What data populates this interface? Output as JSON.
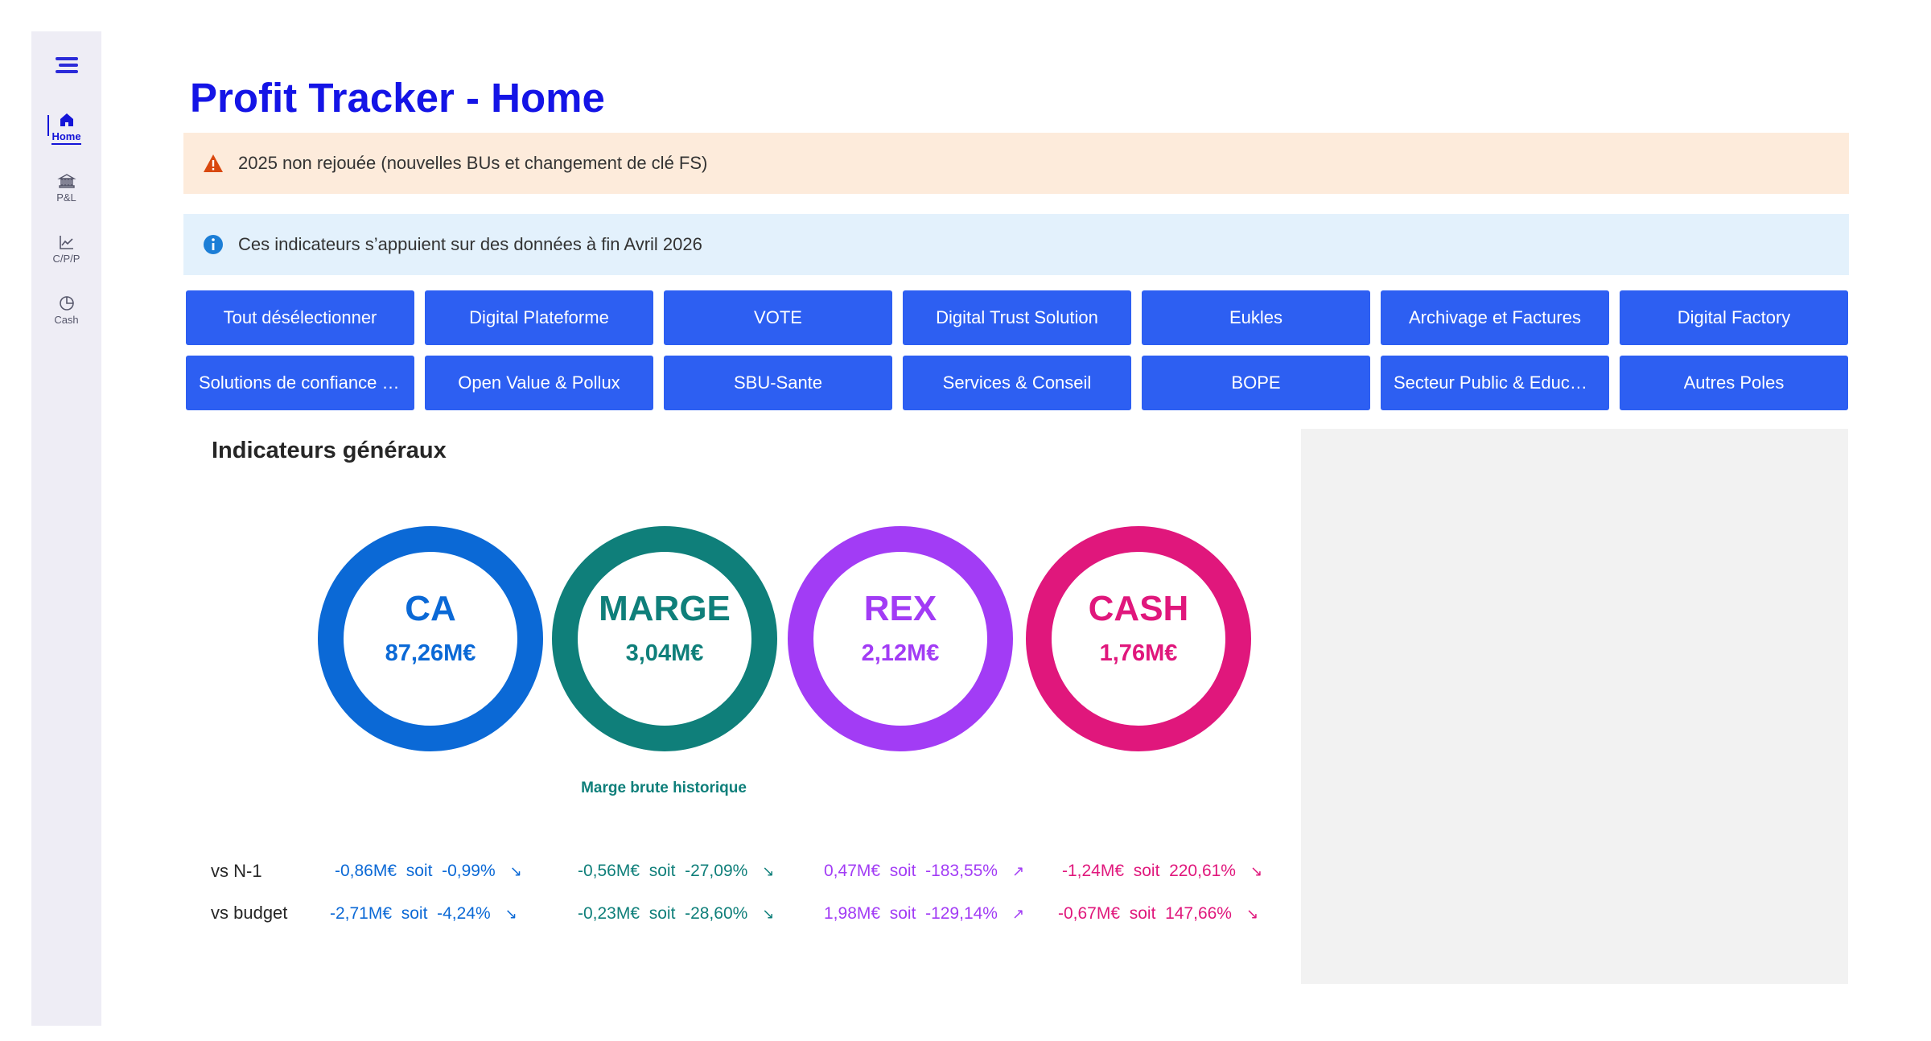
{
  "sidebar": {
    "menu_icon": "hamburger-icon",
    "items": [
      {
        "label": "Home",
        "icon": "home-icon",
        "active": true
      },
      {
        "label": "P&L",
        "icon": "bank-icon",
        "active": false
      },
      {
        "label": "C/P/P",
        "icon": "line-chart-icon",
        "active": false
      },
      {
        "label": "Cash",
        "icon": "pie-chart-icon",
        "active": false
      }
    ]
  },
  "page": {
    "title": "Profit Tracker - Home"
  },
  "alerts": {
    "warning": {
      "text": "2025 non rejouée (nouvelles BUs et changement de clé FS)",
      "icon": "warning-icon",
      "color": "#d9480f"
    },
    "info": {
      "text": "Ces indicateurs s’appuient sur des données à fin Avril 2026",
      "icon": "info-icon",
      "color": "#1c7ed6"
    }
  },
  "filters": [
    "Tout désélectionner",
    "Digital Plateforme",
    "VOTE",
    "Digital Trust Solution",
    "Eukles",
    "Archivage et Factures",
    "Digital Factory",
    "Solutions de confiance Grand Public",
    "Open Value & Pollux",
    "SBU-Sante",
    "Services & Conseil",
    "BOPE",
    "Secteur Public & Education",
    "Autres Poles"
  ],
  "filter_color": "#2d5ff2",
  "section": {
    "title": "Indicateurs généraux"
  },
  "kpis": [
    {
      "name": "CA",
      "value": "87,26M€",
      "color": "#0b69d6"
    },
    {
      "name": "MARGE",
      "value": "3,04M€",
      "color": "#0f7f7a",
      "note": "Marge brute historique"
    },
    {
      "name": "REX",
      "value": "2,12M€",
      "color": "#a23cf5"
    },
    {
      "name": "CASH",
      "value": "1,76M€",
      "color": "#e0177c"
    }
  ],
  "comparisons": {
    "labels": {
      "n1": "vs N-1",
      "budget": "vs budget"
    },
    "soit": "soit",
    "n1": [
      {
        "delta": "-0,86M€",
        "pct": "-0,99%",
        "arrow": "↘"
      },
      {
        "delta": "-0,56M€",
        "pct": "-27,09%",
        "arrow": "↘"
      },
      {
        "delta": "0,47M€",
        "pct": "-183,55%",
        "arrow": "↗"
      },
      {
        "delta": "-1,24M€",
        "pct": "220,61%",
        "arrow": "↘"
      }
    ],
    "budget": [
      {
        "delta": "-2,71M€",
        "pct": "-4,24%",
        "arrow": "↘"
      },
      {
        "delta": "-0,23M€",
        "pct": "-28,60%",
        "arrow": "↘"
      },
      {
        "delta": "1,98M€",
        "pct": "-129,14%",
        "arrow": "↗"
      },
      {
        "delta": "-0,67M€",
        "pct": "147,66%",
        "arrow": "↘"
      }
    ]
  }
}
